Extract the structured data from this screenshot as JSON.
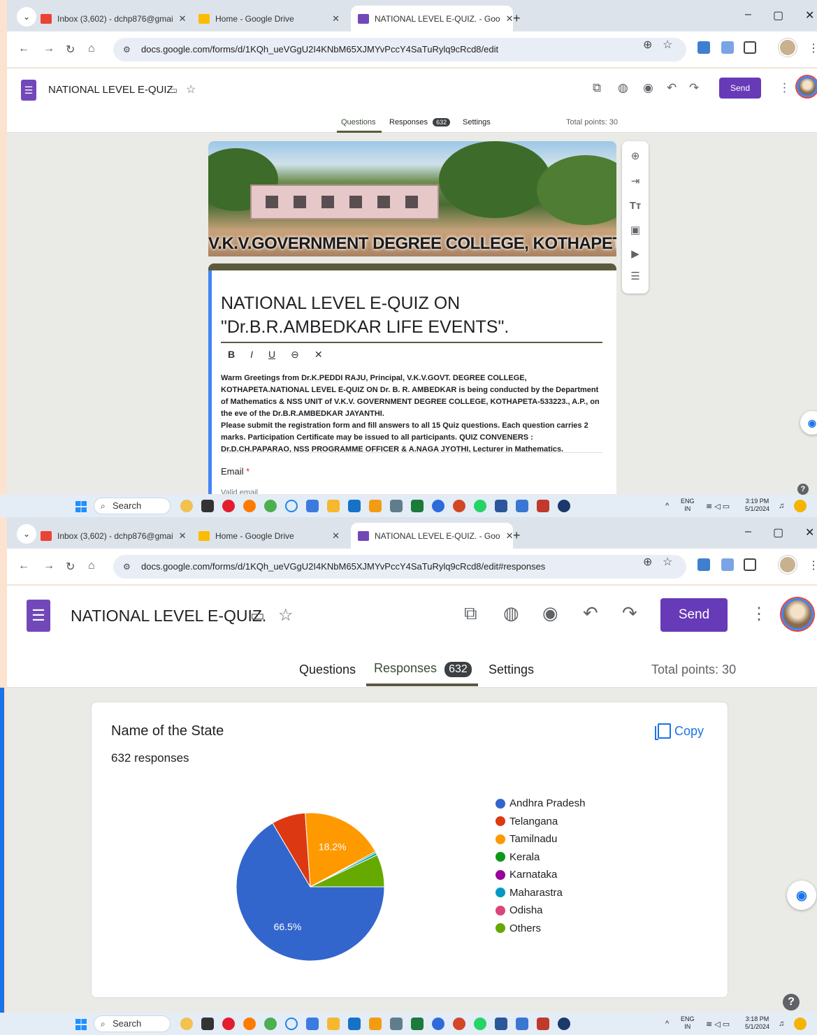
{
  "browser": {
    "tabs": [
      {
        "label": "Inbox (3,602) - dchp876@gmai",
        "favicon_color": "#ea4335"
      },
      {
        "label": "Home - Google Drive",
        "favicon_color": "#fbbc04"
      },
      {
        "label": "NATIONAL LEVEL E-QUIZ. - Goo",
        "favicon_color": "#7248b9"
      }
    ],
    "new_tab": "+",
    "url_edit": "docs.google.com/forms/d/1KQh_ueVGgU2I4KNbM65XJMYvPccY4SaTuRylq9cRcd8/edit",
    "url_responses": "docs.google.com/forms/d/1KQh_ueVGgU2I4KNbM65XJMYvPccY4SaTuRylq9cRcd8/edit#responses"
  },
  "form": {
    "title": "NATIONAL LEVEL E-QUIZ.",
    "send_label": "Send",
    "tabs": {
      "questions": "Questions",
      "responses": "Responses",
      "responses_count": "632",
      "settings": "Settings"
    },
    "total_points": "Total points: 30",
    "banner_caption": "V.K.V.GOVERNMENT DEGREE COLLEGE, KOTHAPETA",
    "quiz_title": "NATIONAL LEVEL E-QUIZ ON \"Dr.B.R.AMBEDKAR LIFE EVENTS\".",
    "format_buttons": [
      "B",
      "I",
      "U",
      "⊖",
      "✕"
    ],
    "description_1": "Warm Greetings from Dr.K.PEDDI RAJU, Principal, V.K.V.GOVT. DEGREE COLLEGE, KOTHAPETA.NATIONAL LEVEL E-QUIZ  ON Dr. B. R. AMBEDKAR is being conducted by the Department of Mathematics & NSS UNIT of V.K.V. GOVERNMENT DEGREE COLLEGE, KOTHAPETA-533223., A.P., on the eve of the  Dr.B.R.AMBEDKAR JAYANTHI.",
    "description_2": " Please submit the registration form and fill answers to all  15 Quiz questions. Each question carries 2 marks. Participation Certificate may be issued to all participants.   QUIZ CONVENERS : Dr.D.CH.PAPARAO, NSS PROGRAMME OFFICER & A.NAGA JYOTHI, Lecturer in Mathematics.",
    "email_label": "Email",
    "required_mark": "*",
    "email_placeholder": "Valid email"
  },
  "responses": {
    "question_title": "Name of the State",
    "response_count": "632 responses",
    "copy_label": "Copy"
  },
  "chart_data": {
    "type": "pie",
    "categories": [
      "Andhra Pradesh",
      "Telangana",
      "Tamilnadu",
      "Kerala",
      "Karnataka",
      "Maharastra",
      "Odisha",
      "Others"
    ],
    "values": [
      66.5,
      7.4,
      18.2,
      0.3,
      0,
      0.5,
      0,
      7.1
    ],
    "colors": [
      "#3366cc",
      "#dc3912",
      "#ff9900",
      "#109618",
      "#990099",
      "#0099c6",
      "#dd4477",
      "#66aa00"
    ],
    "data_labels": {
      "Andhra Pradesh": "66.5%",
      "Tamilnadu": "18.2%"
    },
    "legend_placement": "right"
  },
  "taskbar": {
    "search_label": "Search",
    "lang": "ENG",
    "region": "IN",
    "time_1": "3:19 PM",
    "date_1": "5/1/2024",
    "time_2": "3:18 PM",
    "date_2": "5/1/2024"
  }
}
